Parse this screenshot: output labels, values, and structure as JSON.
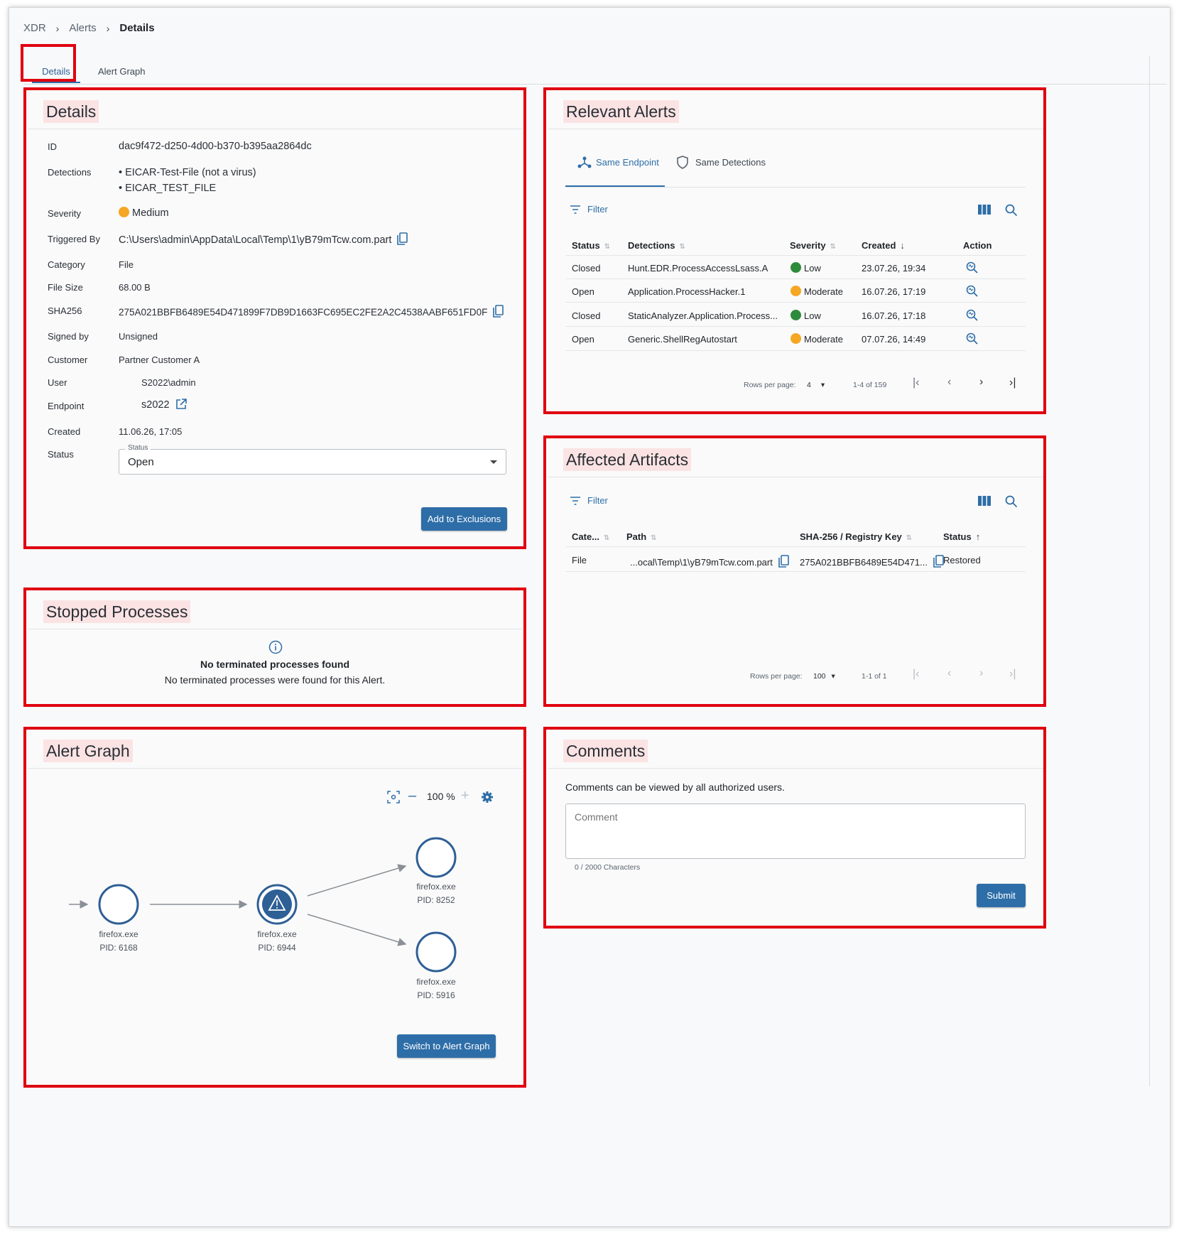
{
  "breadcrumb": {
    "items": [
      "XDR",
      "Alerts",
      "Details"
    ]
  },
  "tabs": {
    "details": "Details",
    "alert_graph": "Alert Graph"
  },
  "details": {
    "title": "Details",
    "fields": {
      "id_label": "ID",
      "id_value": "dac9f472-d250-4d00-b370-b395aa2864dc",
      "detections_label": "Detections",
      "detections": [
        "EICAR-Test-File (not a virus)",
        "EICAR_TEST_FILE"
      ],
      "severity_label": "Severity",
      "severity_value": "Medium",
      "triggered_label": "Triggered By",
      "triggered_value": "C:\\Users\\admin\\AppData\\Local\\Temp\\1\\yB79mTcw.com.part",
      "category_label": "Category",
      "category_value": "File",
      "filesize_label": "File Size",
      "filesize_value": "68.00 B",
      "sha_label": "SHA256",
      "sha_value": "275A021BBFB6489E54D471899F7DB9D1663FC695EC2FE2A2C4538AABF651FD0F",
      "signed_label": "Signed by",
      "signed_value": "Unsigned",
      "customer_label": "Customer",
      "customer_value": "Partner Customer A",
      "user_label": "User",
      "user_value": "S2022\\admin",
      "endpoint_label": "Endpoint",
      "endpoint_value": "s2022",
      "created_label": "Created",
      "created_value": "11.06.26, 17:05",
      "status_label": "Status",
      "status_legend": "Status",
      "status_value": "Open"
    },
    "add_exclusions": "Add to Exclusions"
  },
  "stopped": {
    "title": "Stopped Processes",
    "empty_title": "No terminated processes found",
    "empty_text": "No terminated processes were found for this Alert."
  },
  "graph": {
    "title": "Alert Graph",
    "zoom": "100 %",
    "switch_button": "Switch to Alert Graph",
    "nodes": [
      {
        "name": "firefox.exe",
        "pid": "PID: 6168"
      },
      {
        "name": "firefox.exe",
        "pid": "PID: 6944"
      },
      {
        "name": "firefox.exe",
        "pid": "PID: 8252"
      },
      {
        "name": "firefox.exe",
        "pid": "PID: 5916"
      }
    ]
  },
  "relevant": {
    "title": "Relevant Alerts",
    "tab_endpoint": "Same Endpoint",
    "tab_detections": "Same Detections",
    "filter": "Filter",
    "columns": [
      "Status",
      "Detections",
      "Severity",
      "Created",
      "Action"
    ],
    "rows": [
      {
        "status": "Closed",
        "detection": "Hunt.EDR.ProcessAccessLsass.A",
        "severity": "Low",
        "created": "23.07.26, 19:34"
      },
      {
        "status": "Open",
        "detection": "Application.ProcessHacker.1",
        "severity": "Moderate",
        "created": "16.07.26, 17:19"
      },
      {
        "status": "Closed",
        "detection": "StaticAnalyzer.Application.Process...",
        "severity": "Low",
        "created": "16.07.26, 17:18"
      },
      {
        "status": "Open",
        "detection": "Generic.ShellRegAutostart",
        "severity": "Moderate",
        "created": "07.07.26, 14:49"
      }
    ],
    "rows_per_page_label": "Rows per page:",
    "rows_per_page": "4",
    "range": "1-4 of 159"
  },
  "artifacts": {
    "title": "Affected Artifacts",
    "filter": "Filter",
    "columns": [
      "Cate...",
      "Path",
      "SHA-256 / Registry Key",
      "Status"
    ],
    "rows": [
      {
        "category": "File",
        "path": "...ocal\\Temp\\1\\yB79mTcw.com.part",
        "sha": "275A021BBFB6489E54D471...",
        "status": "Restored"
      }
    ],
    "rows_per_page_label": "Rows per page:",
    "rows_per_page": "100",
    "range": "1-1 of 1"
  },
  "comments": {
    "title": "Comments",
    "note": "Comments can be viewed by all authorized users.",
    "placeholder": "Comment",
    "counter": "0 / 2000 Characters",
    "submit": "Submit"
  },
  "colors": {
    "accent": "#2e6ea8",
    "medium": "#f5a623",
    "low": "#2e8b3c",
    "moderate": "#f5a623",
    "annotation": "#e00010"
  }
}
